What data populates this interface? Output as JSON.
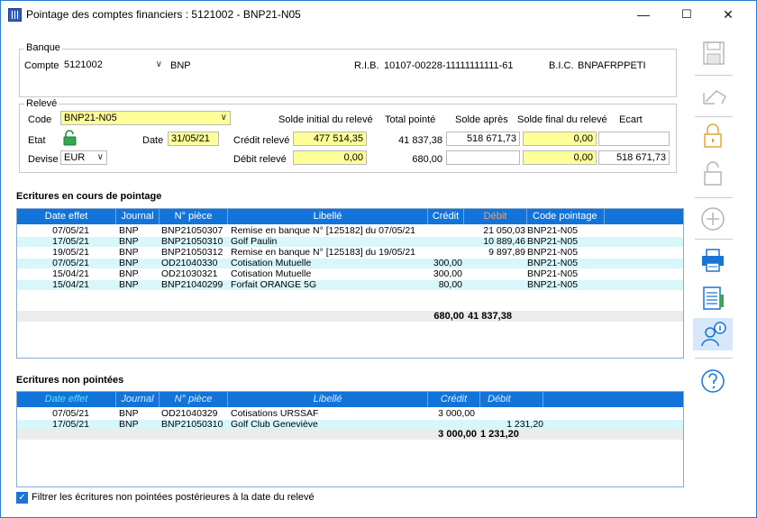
{
  "window": {
    "title": "Pointage des comptes financiers : 5121002 - BNP21-N05",
    "minimize": "—",
    "maximize": "☐",
    "close": "✕"
  },
  "banque": {
    "group_label": "Banque",
    "compte_label": "Compte",
    "compte_value": "5121002",
    "bank_name": "BNP",
    "rib_label": "R.I.B.",
    "rib_value": "10107-00228-11111111111-61",
    "bic_label": "B.I.C.",
    "bic_value": "BNPAFRPPETI"
  },
  "releve": {
    "group_label": "Relevé",
    "code_label": "Code",
    "code_value": "BNP21-N05",
    "etat_label": "Etat",
    "date_label": "Date",
    "date_value": "31/05/21",
    "devise_label": "Devise",
    "devise_value": "EUR",
    "col_solde_initial": "Solde initial du relevé",
    "col_total_pointe": "Total pointé",
    "col_solde_apres": "Solde après",
    "col_solde_final": "Solde final du relevé",
    "col_ecart": "Ecart",
    "credit_label": "Crédit relevé",
    "credit_solde_initial": "477 514,35",
    "credit_total_pointe": "41 837,38",
    "credit_solde_apres": "518 671,73",
    "credit_solde_final": "0,00",
    "credit_ecart": "",
    "debit_label": "Débit relevé",
    "debit_solde_initial": "0,00",
    "debit_total_pointe": "680,00",
    "debit_solde_apres": "",
    "debit_solde_final": "0,00",
    "debit_ecart": "518 671,73"
  },
  "pointage": {
    "title": "Ecritures en cours de pointage",
    "headers": [
      "Date effet",
      "Journal",
      "N° pièce",
      "Libellé",
      "Crédit",
      "Débit",
      "Code pointage"
    ],
    "rows": [
      {
        "date": "07/05/21",
        "journal": "BNP",
        "piece": "BNP21050307",
        "libelle": "Remise en banque N° [125182] du 07/05/21",
        "credit": "",
        "debit": "21 050,03",
        "code": "BNP21-N05"
      },
      {
        "date": "17/05/21",
        "journal": "BNP",
        "piece": "BNP21050310",
        "libelle": "Golf Paulin",
        "credit": "",
        "debit": "10 889,46",
        "code": "BNP21-N05"
      },
      {
        "date": "19/05/21",
        "journal": "BNP",
        "piece": "BNP21050312",
        "libelle": "Remise en banque N° [125183] du 19/05/21",
        "credit": "",
        "debit": "9 897,89",
        "code": "BNP21-N05"
      },
      {
        "date": "07/05/21",
        "journal": "BNP",
        "piece": "OD21040330",
        "libelle": "Cotisation Mutuelle",
        "credit": "300,00",
        "debit": "",
        "code": "BNP21-N05"
      },
      {
        "date": "15/04/21",
        "journal": "BNP",
        "piece": "OD21030321",
        "libelle": "Cotisation Mutuelle",
        "credit": "300,00",
        "debit": "",
        "code": "BNP21-N05"
      },
      {
        "date": "15/04/21",
        "journal": "BNP",
        "piece": "BNP21040299",
        "libelle": "Forfait ORANGE 5G",
        "credit": "80,00",
        "debit": "",
        "code": "BNP21-N05"
      }
    ],
    "total_credit": "680,00",
    "total_debit": "41 837,38"
  },
  "non_pointees": {
    "title": "Ecritures non pointées",
    "headers": [
      "Date effet",
      "Journal",
      "N° pièce",
      "Libellé",
      "Crédit",
      "Débit"
    ],
    "rows": [
      {
        "date": "07/05/21",
        "journal": "BNP",
        "piece": "OD21040329",
        "libelle": "Cotisations URSSAF",
        "credit": "3 000,00",
        "debit": ""
      },
      {
        "date": "17/05/21",
        "journal": "BNP",
        "piece": "BNP21050310",
        "libelle": "Golf Club Geneviève",
        "credit": "",
        "debit": "1 231,20"
      }
    ],
    "total_credit": "3 000,00",
    "total_debit": "1 231,20"
  },
  "filter": {
    "label": "Filtrer les écritures non pointées postérieures à la date du relevé",
    "checked": true
  },
  "sidebar_icons": [
    "save-icon",
    "undo-icon",
    "lock-icon",
    "unlock-icon",
    "add-icon",
    "print-icon",
    "report-icon",
    "user-info-icon",
    "help-icon"
  ],
  "colors": {
    "grid_header": "#1274d8",
    "row_alt": "#d7f7fb",
    "yellow_field": "#ffff99",
    "accent": "#1a73d5"
  }
}
